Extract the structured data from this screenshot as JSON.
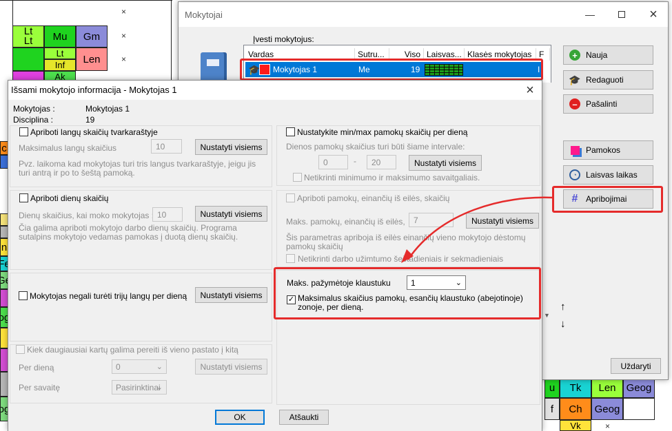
{
  "background_grid": {
    "cells": [
      "Lt",
      "Lt",
      "Mu",
      "Gm",
      "Lt",
      "Inf",
      "Len",
      "Ak",
      "Tk",
      "Len",
      "Geog",
      "Ch",
      "Geog",
      "Vk",
      "u",
      "f"
    ],
    "close_mark": "×",
    "left_fragments": [
      "c",
      "n",
      "Fe",
      "Ge",
      "og",
      "og"
    ]
  },
  "main_window": {
    "title": "Mokytojai",
    "list_label": "Įvesti mokytojus:",
    "columns": [
      "Vardas",
      "Sutru...",
      "Viso",
      "Laisvas...",
      "Klasės mokytojas",
      "F"
    ],
    "row": {
      "name": "Mokytojas 1",
      "short": "Me",
      "total": "19",
      "tail": "I"
    },
    "buttons": {
      "new": "Nauja",
      "edit": "Redaguoti",
      "delete": "Pašalinti",
      "lessons": "Pamokos",
      "free_time": "Laisvas laikas",
      "constraints": "Apribojimai",
      "close": "Uždaryti"
    },
    "arrow_up": "↑",
    "arrow_down": "↓"
  },
  "detail_dialog": {
    "title": "Išsami mokytojo informacija - Mokytojas 1",
    "teacher_label": "Mokytojas :",
    "teacher_value": "Mokytojas 1",
    "discipline_label": "Disciplina :",
    "discipline_value": "19",
    "set_all": "Nustatyti visiems",
    "gaps": {
      "check_label": "Apriboti langų skaičių tvarkaraštyje",
      "max_label": "Maksimalus langų skaičius",
      "max_value": "10",
      "note": "Pvz. laikoma kad mokytojas turi tris langus tvarkaraštyje, jeigu jis turi antrą ir po to šeštą pamoką."
    },
    "days": {
      "check_label": "Apriboti dienų skaičių",
      "count_label": "Dienų skaičius, kai moko mokytojas :",
      "count_value": "10",
      "note": "Čia galima apriboti mokytojo darbo dienų skaičių. Programa sutalpins mokytojo vedamas pamokas į duotą dienų skaičių."
    },
    "three_gaps": {
      "check_label": "Mokytojas negali turėti trijų langų per dieną"
    },
    "building": {
      "check_label": "Kiek daugiausiai kartų galima pereiti iš vieno pastato į kitą",
      "per_day_label": "Per dieną",
      "per_day_value": "0",
      "per_week_label": "Per savaitę",
      "per_week_value": "Pasirinktinai"
    },
    "minmax": {
      "check_label": "Nustatykite min/max pamokų skaičių per dieną",
      "range_label": "Dienos pamokų skaičius turi būti šiame intervale:",
      "min_value": "0",
      "dash": "-",
      "max_value": "20",
      "weekend_label": "Netikrinti minimumo ir maksimumo savaitgaliais."
    },
    "consecutive": {
      "check_label": "Apriboti pamokų, einančių iš eilės, skaičių",
      "max_label": "Maks. pamokų, einančių iš eilės,",
      "max_value": "7",
      "note": "Šis parametras apriboja iš eilės einančių vieno mokytojo dėstomų pamokų skaičių",
      "weekend_label": "Netikrinti darbo užimtumo šeštadieniais ir sekmadieniais"
    },
    "marked": {
      "label": "Maks. pažymėtoje klaustuku",
      "value": "1",
      "check_label": "Maksimalus skaičius pamokų, esančių klaustuko (abejotinoje) zonoje, per dieną."
    },
    "ok": "OK",
    "cancel": "Atšaukti"
  },
  "colors": {
    "annotation_red": "#e52b2b",
    "selection_blue": "#0078d7"
  }
}
